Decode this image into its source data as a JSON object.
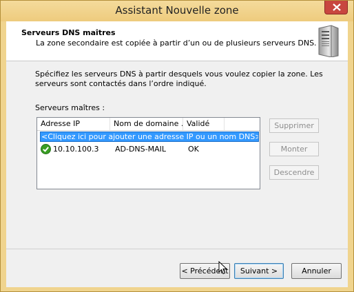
{
  "window": {
    "title": "Assistant Nouvelle zone"
  },
  "header": {
    "title": "Serveurs DNS maîtres",
    "subtitle": "La zone secondaire est copiée à partir d’un ou de plusieurs serveurs DNS."
  },
  "body": {
    "description": "Spécifiez les serveurs DNS à partir desquels vous voulez copier la zone. Les serveurs sont contactés dans l’ordre indiqué.",
    "list_label": "Serveurs maîtres :"
  },
  "list": {
    "columns": [
      "Adresse IP",
      "Nom de domaine ...",
      "Validé"
    ],
    "add_placeholder": "<Cliquez ici pour ajouter une adresse IP ou un nom DNS>",
    "rows": [
      {
        "ip": "10.10.100.3",
        "name": "AD-DNS-MAIL",
        "status": "OK",
        "status_icon": "check-icon"
      }
    ]
  },
  "side_buttons": {
    "delete": "Supprimer",
    "up": "Monter",
    "down": "Descendre"
  },
  "footer": {
    "back": "< Précédent",
    "next": "Suivant >",
    "cancel": "Annuler"
  },
  "colors": {
    "accent": "#3399ff",
    "titlebar": "#eecb7d",
    "close": "#c8463f",
    "ok": "#3a9d23"
  }
}
